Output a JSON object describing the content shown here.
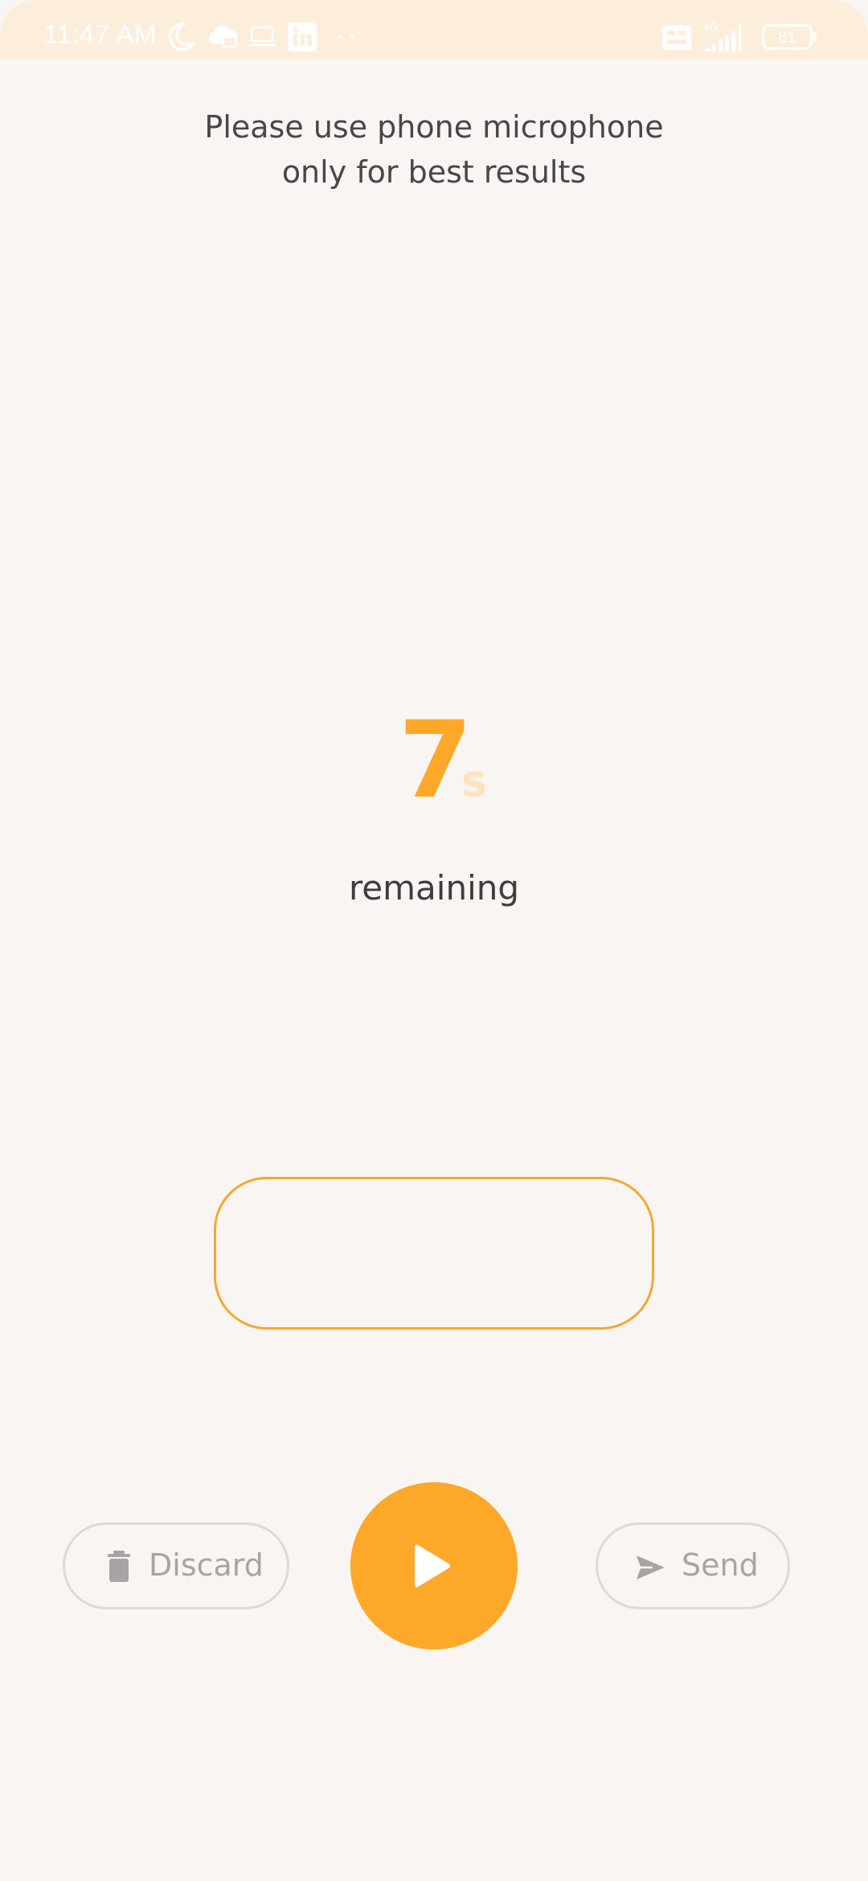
{
  "status_bar": {
    "time": "11:47 AM",
    "icons": [
      "moon-icon",
      "cloud-sync-icon",
      "laptop-icon",
      "linkedin-icon",
      "more-dots-icon",
      "volte-icon",
      "signal-4g-icon",
      "battery-icon"
    ],
    "network": "4G",
    "battery_level": "81"
  },
  "instruction": {
    "line1": "Please use phone microphone",
    "line2": "only for best results"
  },
  "countdown": {
    "value": "7",
    "unit": "s",
    "caption": "remaining"
  },
  "controls": {
    "discard_label": "Discard",
    "send_label": "Send",
    "play_icon": "play-icon",
    "discard_icon": "trash-icon",
    "send_icon": "send-icon"
  },
  "colors": {
    "accent": "#fda828",
    "background": "#f9f5f2",
    "status_bar": "#fdeedb",
    "text": "#49454a",
    "muted": "#a8a4a3"
  }
}
